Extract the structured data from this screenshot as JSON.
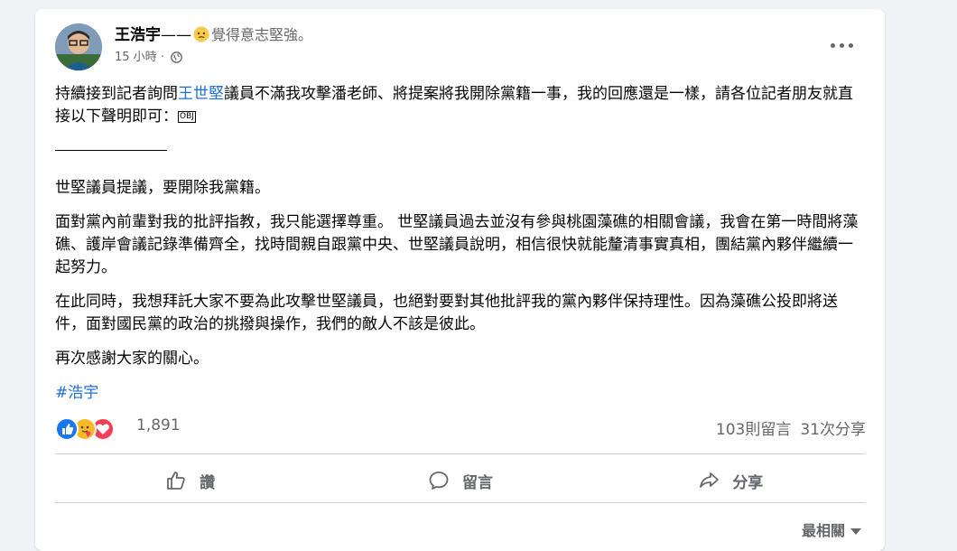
{
  "post": {
    "author": "王浩宇",
    "dash": "——",
    "feeling": "覺得意志堅強。",
    "time": "15 小時",
    "dot": "·",
    "paragraphs": {
      "p1_before": "持續接到記者詢問",
      "p1_link": "王世堅",
      "p1_after": "議員不滿我攻擊潘老師、將提案將我開除黨籍一事，我的回應還是一樣，請各位記者朋友就直接以下聲明即可：",
      "p1_obj": "OBJ",
      "p2": "世堅議員提議，要開除我黨籍。",
      "p3": "面對黨內前輩對我的批評指教，我只能選擇尊重。 世堅議員過去並沒有參與桃園藻礁的相關會議，我會在第一時間將藻礁、護岸會議記錄準備齊全，找時間親自跟黨中央、世堅議員說明，相信很快就能釐清事實真相，團結黨內夥伴繼續一起努力。",
      "p4": "在此同時，我想拜託大家不要為此攻擊世堅議員，也絕對要對其他批評我的黨內夥伴保持理性。因為藻礁公投即將送件，面對國民黨的政治的挑撥與操作，我們的敵人不該是彼此。",
      "p5": "再次感謝大家的關心。"
    },
    "hashtag": "#浩宇"
  },
  "stats": {
    "reaction_count": "1,891",
    "comments": "103則留言",
    "shares": "31次分享"
  },
  "actions": {
    "like": "讚",
    "comment": "留言",
    "share": "分享"
  },
  "sort": {
    "label": "最相關"
  },
  "colors": {
    "link": "#216fdb",
    "muted": "#65676b",
    "like_blue": "#1877f2",
    "love_red": "#f33e58",
    "care_yellow": "#f7b928"
  },
  "icons": [
    "avatar",
    "strong-emoji-icon",
    "globe-icon",
    "more-icon",
    "like-reaction-icon",
    "care-reaction-icon",
    "love-reaction-icon",
    "thumbs-up-icon",
    "comment-bubble-icon",
    "share-arrow-icon",
    "caret-down-icon"
  ]
}
